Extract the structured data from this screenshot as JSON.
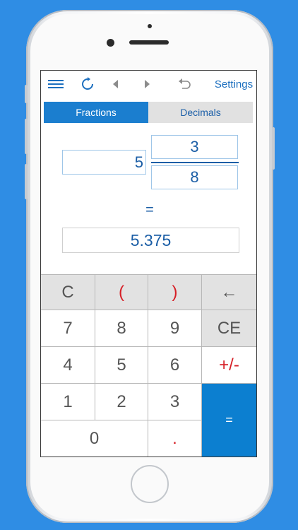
{
  "toolbar": {
    "menu_icon": "menu-icon",
    "refresh_icon": "refresh-icon",
    "back_icon": "back-arrow-icon",
    "forward_icon": "forward-arrow-icon",
    "undo_icon": "undo-icon",
    "settings_label": "Settings"
  },
  "tabs": [
    {
      "label": "Fractions",
      "active": true
    },
    {
      "label": "Decimals",
      "active": false
    }
  ],
  "fraction": {
    "whole": "5",
    "numerator": "3",
    "denominator": "8"
  },
  "equals_sign": "=",
  "result": "5.375",
  "keys": {
    "clear": "C",
    "open_paren": "(",
    "close_paren": ")",
    "backspace": "←",
    "seven": "7",
    "eight": "8",
    "nine": "9",
    "clear_entry": "CE",
    "four": "4",
    "five": "5",
    "six": "6",
    "plus_minus": "+/-",
    "one": "1",
    "two": "2",
    "three": "3",
    "equals": "=",
    "zero": "0",
    "dot": "."
  },
  "colors": {
    "accent": "#1b7ecf",
    "text_blue": "#1b5ea6",
    "red": "#d61f26",
    "background": "#2f8de4"
  }
}
